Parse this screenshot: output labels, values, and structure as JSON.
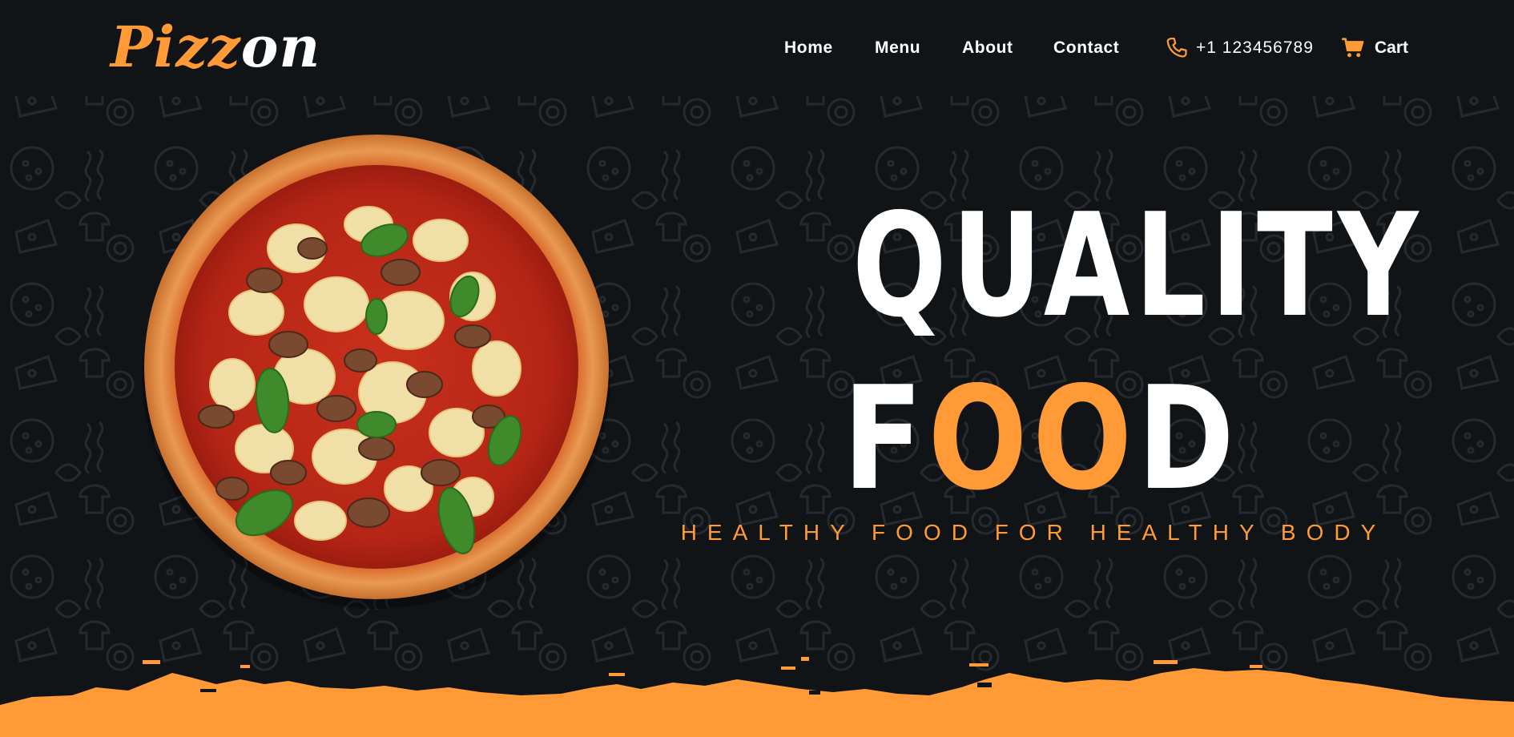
{
  "brand": {
    "logo_part1": "Pizz",
    "logo_part2": "on"
  },
  "nav": {
    "items": [
      {
        "label": "Home"
      },
      {
        "label": "Menu"
      },
      {
        "label": "About"
      },
      {
        "label": "Contact"
      }
    ]
  },
  "contact": {
    "phone": "+1 123456789",
    "phone_icon": "phone-icon"
  },
  "cart": {
    "label": "Cart",
    "icon": "cart-icon"
  },
  "hero": {
    "headline_line1": "QUALITY",
    "headline_line2_start": "F",
    "headline_line2_accent": "OO",
    "headline_line2_end": "D",
    "tagline": "HEALTHY FOOD FOR HEALTHY BODY",
    "image": "pizza-image"
  },
  "colors": {
    "background": "#111417",
    "accent": "#ff9a36",
    "text": "#ffffff"
  }
}
